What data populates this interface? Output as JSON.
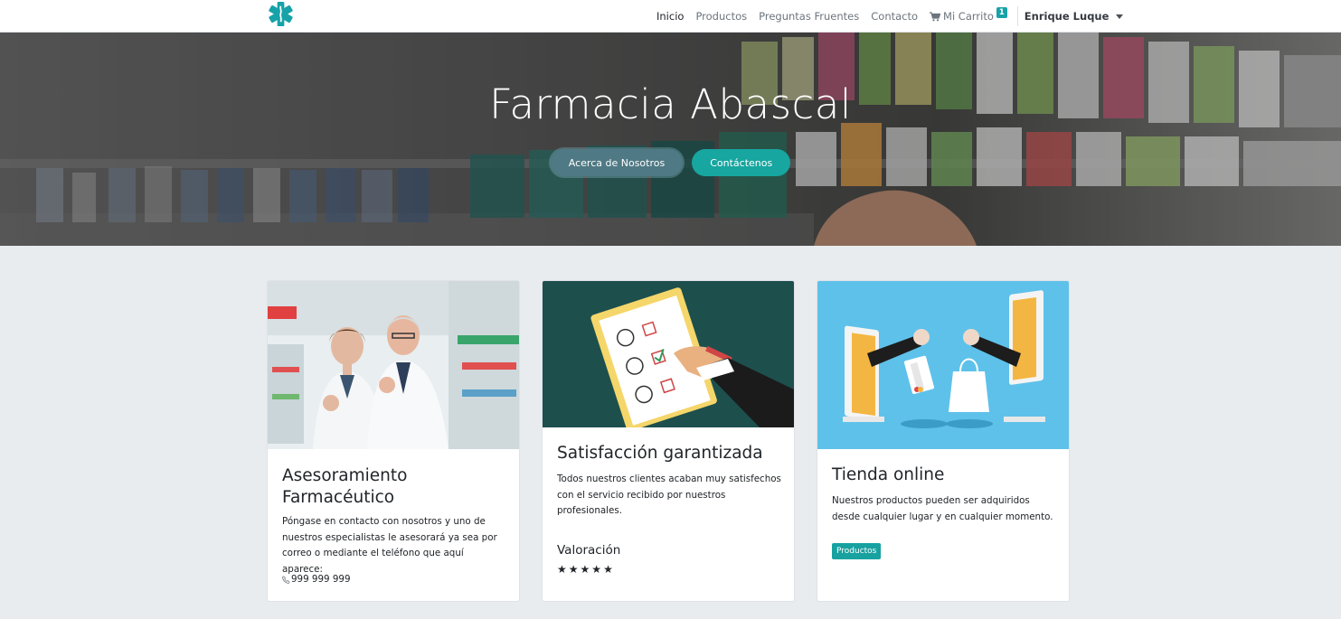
{
  "nav": {
    "items": [
      {
        "label": "Inicio"
      },
      {
        "label": "Productos"
      },
      {
        "label": "Preguntas Fruentes"
      },
      {
        "label": "Contacto"
      }
    ],
    "cart_label": "Mi Carrito",
    "cart_count": "1",
    "user_name": "Enrique Luque",
    "brand_color": "#17a2a8"
  },
  "hero": {
    "title": "Farmacia Abascal",
    "about_button": "Acerca de Nosotros",
    "contact_button": "Contáctenos"
  },
  "cards": [
    {
      "title": "Asesoramiento Farmacéutico",
      "text": "Póngase en contacto con nosotros y uno de nuestros especialistas le asesorará ya sea por correo o mediante el teléfono que aquí aparece:",
      "phone": "999 999 999"
    },
    {
      "title": "Satisfacción garantizada",
      "text": "Todos nuestros clientes acaban muy satisfechos con el servicio recibido por nuestros profesionales.",
      "rating_label": "Valoración",
      "stars": 5
    },
    {
      "title": "Tienda online",
      "text": "Nuestros productos pueden ser adquiridos desde cualquier lugar y en cualquier momento.",
      "button": "Productos"
    }
  ]
}
